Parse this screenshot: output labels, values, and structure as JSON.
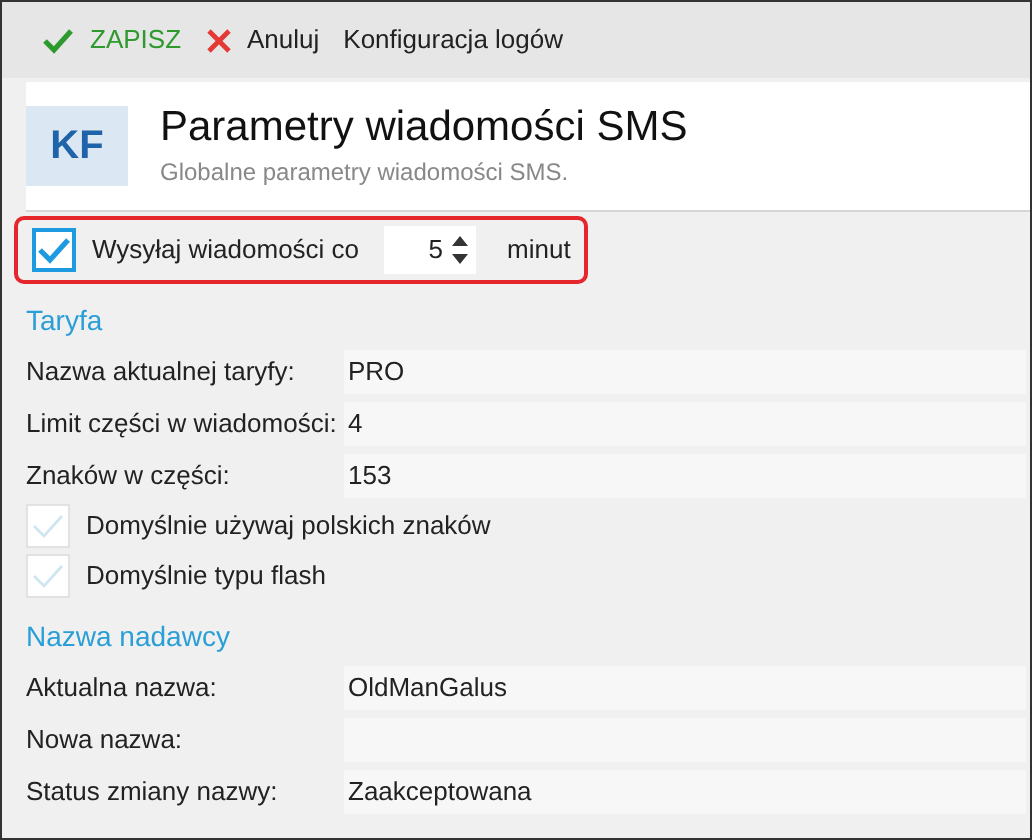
{
  "toolbar": [
    {
      "kind": "save",
      "label": "ZAPISZ"
    },
    {
      "kind": "cancel",
      "label": "Anuluj"
    },
    {
      "kind": "plain",
      "label": "Konfiguracja logów"
    }
  ],
  "header": {
    "badge": "KF",
    "title": "Parametry wiadomości SMS",
    "subtitle": "Globalne parametry wiadomości SMS."
  },
  "send_option": {
    "checked": true,
    "label": "Wysyłaj wiadomości co",
    "value": "5",
    "unit": "minut",
    "highlighted": true
  },
  "sections": [
    {
      "title": "Taryfa",
      "items": [
        {
          "kind": "field",
          "label": "Nazwa aktualnej taryfy:",
          "value": "PRO"
        },
        {
          "kind": "field",
          "label": "Limit części w wiadomości:",
          "value": "4"
        },
        {
          "kind": "field",
          "label": "Znaków w części:",
          "value": "153"
        },
        {
          "kind": "checkbox",
          "label": "Domyślnie używaj polskich znaków",
          "checked": false
        },
        {
          "kind": "checkbox",
          "label": "Domyślnie typu flash",
          "checked": false
        }
      ]
    },
    {
      "title": "Nazwa nadawcy",
      "items": [
        {
          "kind": "field",
          "label": "Aktualna nazwa:",
          "value": "OldManGalus"
        },
        {
          "kind": "field",
          "label": "Nowa nazwa:"
        },
        {
          "kind": "field",
          "label": "Status zmiany nazwy:",
          "value": "Zaakceptowana"
        }
      ]
    }
  ]
}
